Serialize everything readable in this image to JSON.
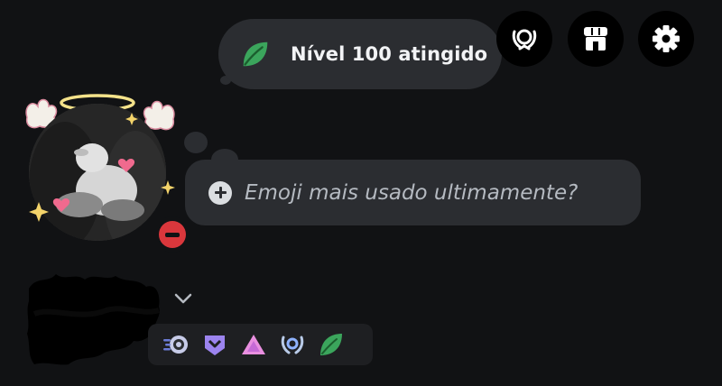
{
  "level_bubble": {
    "text": "Nível 100 atingido",
    "icon": "leaf-icon"
  },
  "header_buttons": [
    {
      "icon": "badge-laurel-icon",
      "label": ""
    },
    {
      "icon": "shop-icon",
      "label": ""
    },
    {
      "icon": "gear-icon",
      "label": ""
    }
  ],
  "profile": {
    "status": "dnd",
    "status_color": "#da373c",
    "custom_status_placeholder": "Emoji mais usado ultimamente?"
  },
  "badges": [
    {
      "icon": "nitro-boost-icon"
    },
    {
      "icon": "hypesquad-bravery-icon"
    },
    {
      "icon": "triangle-badge-icon"
    },
    {
      "icon": "laurel-badge-icon"
    },
    {
      "icon": "leaf-quest-icon"
    }
  ],
  "colors": {
    "background": "#111214",
    "bubble": "#2b2d31",
    "accent_green": "#3ba55c",
    "hypesquad_purple": "#9c84ef",
    "triangle_pink": "#e98fe0"
  }
}
